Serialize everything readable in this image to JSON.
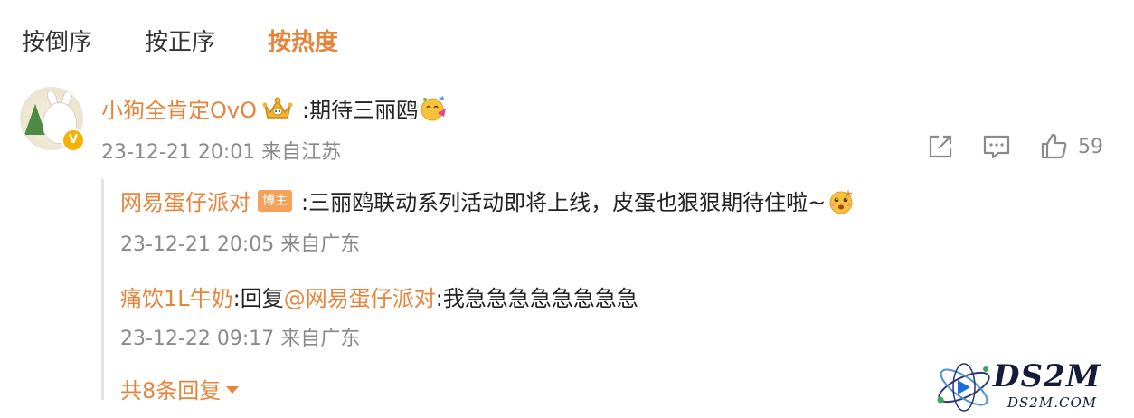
{
  "tabs": [
    {
      "label": "按倒序",
      "active": false
    },
    {
      "label": "按正序",
      "active": false
    },
    {
      "label": "按热度",
      "active": true
    }
  ],
  "comment": {
    "username": "小狗全肯定OvO",
    "text": ":期待三丽鸥",
    "timestamp": "23-12-21 20:01 来自江苏",
    "like_count": "59",
    "avatar_badge": "V"
  },
  "replies": [
    {
      "username": "网易蛋仔派对",
      "badge": "博主",
      "text": ":三丽鸥联动系列活动即将上线，皮蛋也狠狠期待住啦~",
      "timestamp": "23-12-21 20:05 来自广东"
    },
    {
      "username": "痛饮1L牛奶",
      "reply_prefix": ":回复",
      "mention": "@网易蛋仔派对",
      "text": ":我急急急急急急急急",
      "timestamp": "23-12-22 09:17 来自广东"
    }
  ],
  "more_replies_label": "共8条回复",
  "watermark": {
    "title": "DS2M",
    "subtitle": "DS2M.COM"
  },
  "colors": {
    "accent": "#e8843a",
    "meta_text": "#8a8a8a",
    "badge_bg": "#f5a15a",
    "verified": "#f5b100"
  }
}
